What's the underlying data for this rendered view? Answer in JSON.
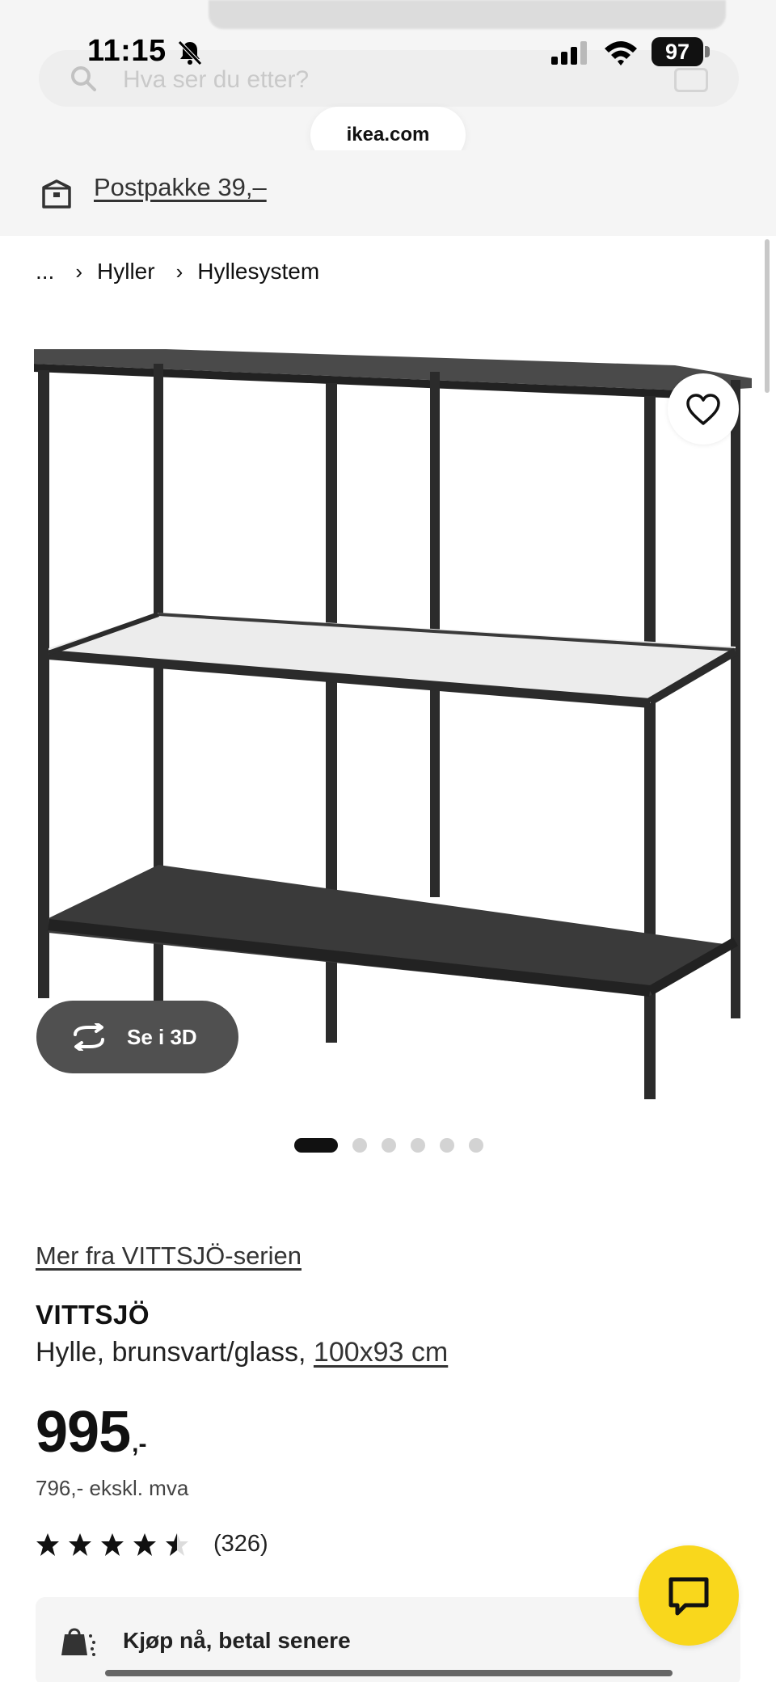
{
  "status_bar": {
    "time": "11:15",
    "battery": "97"
  },
  "browser": {
    "url": "ikea.com",
    "search_placeholder": "Hva ser du etter?"
  },
  "delivery": {
    "label": "Postpakke 39,–"
  },
  "breadcrumb": {
    "ellipsis": "...",
    "items": [
      "Hyller",
      "Hyllesystem"
    ]
  },
  "gallery": {
    "see_3d_label": "Se i 3D",
    "slide_count": 6,
    "active_slide": 1
  },
  "product": {
    "series_link": "Mer fra VITTSJÖ-serien",
    "name": "VITTSJÖ",
    "description": "Hylle, brunsvart/glass,",
    "size_link": "100x93 cm",
    "price_amount": "995",
    "price_suffix": ",-",
    "price_ex_vat": "796,- ekskl. mva",
    "rating": 4.5,
    "review_count": "(326)"
  },
  "bnpl": {
    "label": "Kjøp nå, betal senere"
  },
  "colors": {
    "ikea_yellow": "#f9d71c",
    "frame": "#2b2b2b",
    "button_dark": "#505050"
  }
}
